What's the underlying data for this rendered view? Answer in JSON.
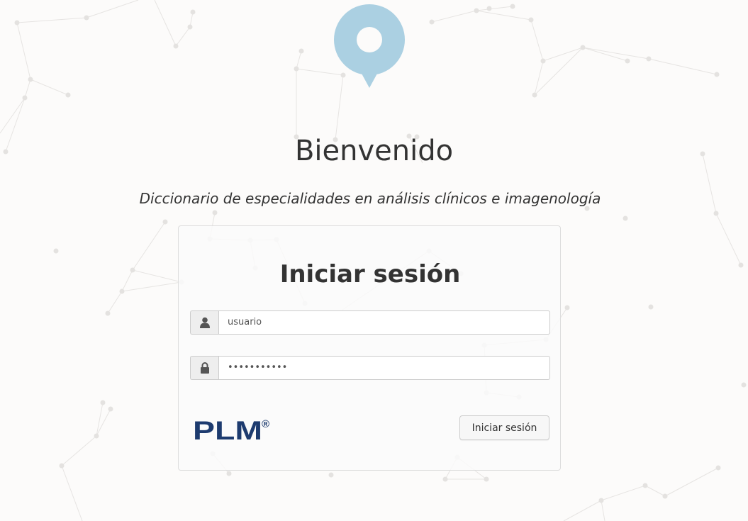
{
  "header": {
    "welcome": "Bienvenido",
    "subtitle": "Diccionario de especialidades en análisis clínicos e imagenología"
  },
  "login": {
    "title": "Iniciar sesión",
    "username_value": "usuario",
    "password_value": "•••••••••••",
    "submit_label": "Iniciar sesión"
  },
  "brand": {
    "logo_text": "PLM",
    "registered_mark": "®"
  },
  "icons": {
    "pin": "map-pin-icon",
    "user": "user-icon",
    "lock": "lock-icon"
  },
  "colors": {
    "pin": "#abd0e2",
    "logo": "#1d3b6f",
    "background": "#fcfbfa"
  }
}
